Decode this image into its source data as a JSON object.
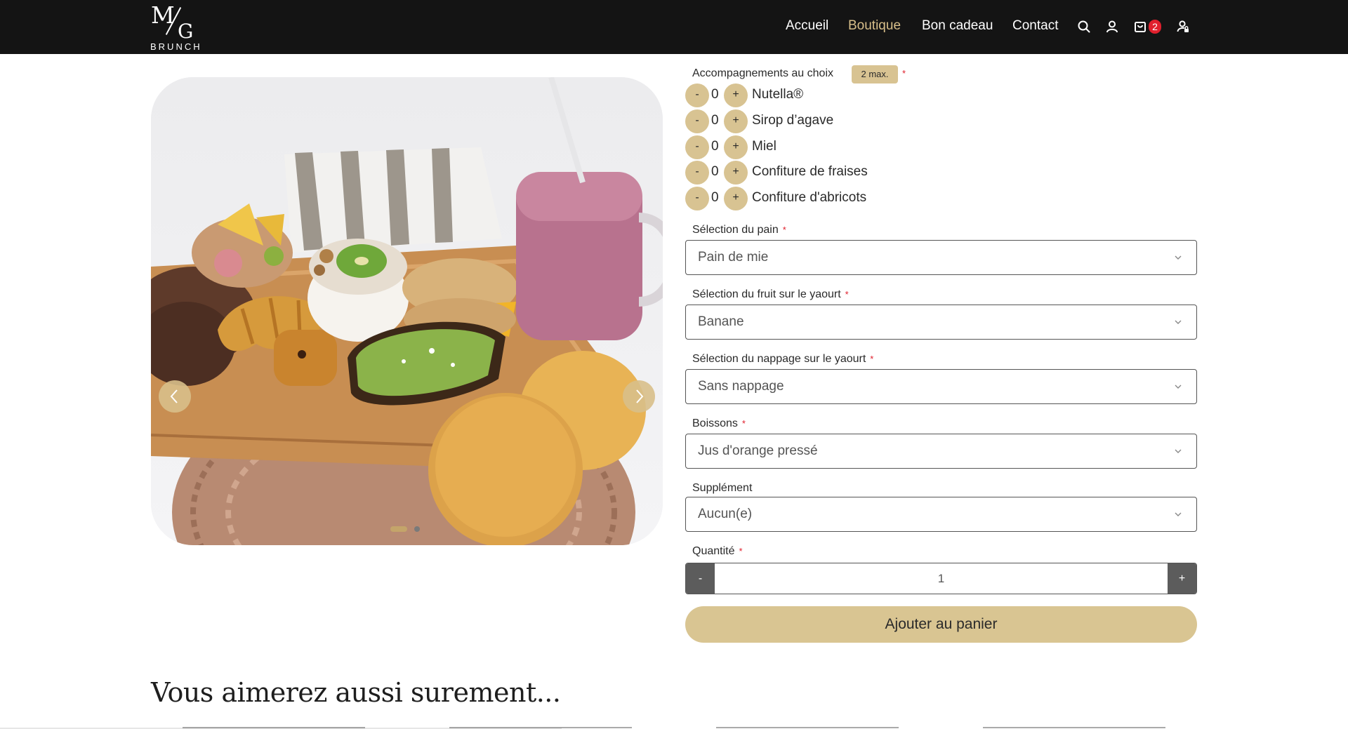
{
  "header": {
    "logo_text": "M/G",
    "logo_sub": "BRUNCH",
    "nav": [
      {
        "label": "Accueil"
      },
      {
        "label": "Boutique"
      },
      {
        "label": "Bon cadeau"
      },
      {
        "label": "Contact"
      }
    ],
    "active_nav": "Boutique",
    "cart_count": "2",
    "icons": [
      "search-icon",
      "user-icon",
      "cart-icon",
      "account-lock-icon"
    ]
  },
  "gallery": {
    "slide_current": 1,
    "slide_total": 2,
    "prev_icon": "chevron-left-icon",
    "next_icon": "chevron-right-icon"
  },
  "form": {
    "accompaniments": {
      "label": "Accompagnements au choix",
      "max_badge": "2 max.",
      "items": [
        {
          "name": "Nutella®",
          "qty": "0"
        },
        {
          "name": "Sirop d’agave",
          "qty": "0"
        },
        {
          "name": "Miel",
          "qty": "0"
        },
        {
          "name": "Confiture de fraises",
          "qty": "0"
        },
        {
          "name": "Confiture d'abricots",
          "qty": "0"
        }
      ],
      "minus": "-",
      "plus": "+"
    },
    "pain": {
      "label": "Sélection du pain",
      "value": "Pain de mie"
    },
    "fruit": {
      "label": "Sélection du fruit sur le yaourt",
      "value": "Banane"
    },
    "nappage": {
      "label": "Sélection du nappage sur le yaourt",
      "value": "Sans nappage"
    },
    "boissons": {
      "label": "Boissons",
      "value": "Jus d'orange pressé"
    },
    "supplement": {
      "label": "Supplément",
      "value": "Aucun(e)"
    },
    "quantite": {
      "label": "Quantité",
      "value": "1",
      "minus": "-",
      "plus": "+"
    },
    "add_to_cart": "Ajouter au panier",
    "required_mark": "*"
  },
  "related": {
    "title": "Vous aimerez aussi surement..."
  },
  "colors": {
    "header_bg": "#141414",
    "accent": "#d8bf8a",
    "button_gold": "#d9c592",
    "badge_red": "#e0202d",
    "qty_btn": "#5c5c5c"
  }
}
